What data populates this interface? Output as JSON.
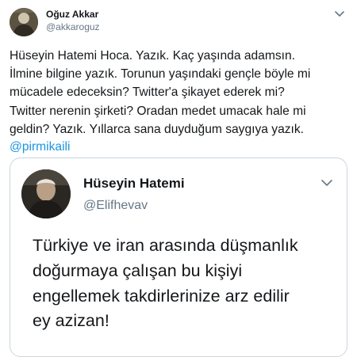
{
  "tweet": {
    "author_name": "Oğuz Akkar",
    "author_handle": "@akkaroguz",
    "text": "Hüseyin Hatemi Hoca. Yazık. Kaç yaşında adamsın.\nİlmine bilgine yazık. Torunun yaşındaki gençle böyle mi\nmücadele edeceksin? Twitter'a şikayet ederek mi?\nTwitter nerenin şirketi? Oradan medet umacak hale mi\ngeldin? Yazık. Yıllarca sana duyduğum saygıya yazık.",
    "mention": "@pirmikaili",
    "menu_icon": "chevron-down-icon"
  },
  "quoted_tweet": {
    "author_name": "Hüseyin Hatemi",
    "author_handle": "@Elifhevav",
    "text": "Türkiye ve iran arasında düşmanlık\ndoğurmaya çalışan bu kişiyi\nengellemek takdirlerinize arz edilir\ney azizan!",
    "menu_icon": "chevron-down-icon"
  },
  "colors": {
    "text": "#14171a",
    "secondary": "#657786",
    "link": "#1b95e0",
    "border": "#ccd6dd"
  }
}
